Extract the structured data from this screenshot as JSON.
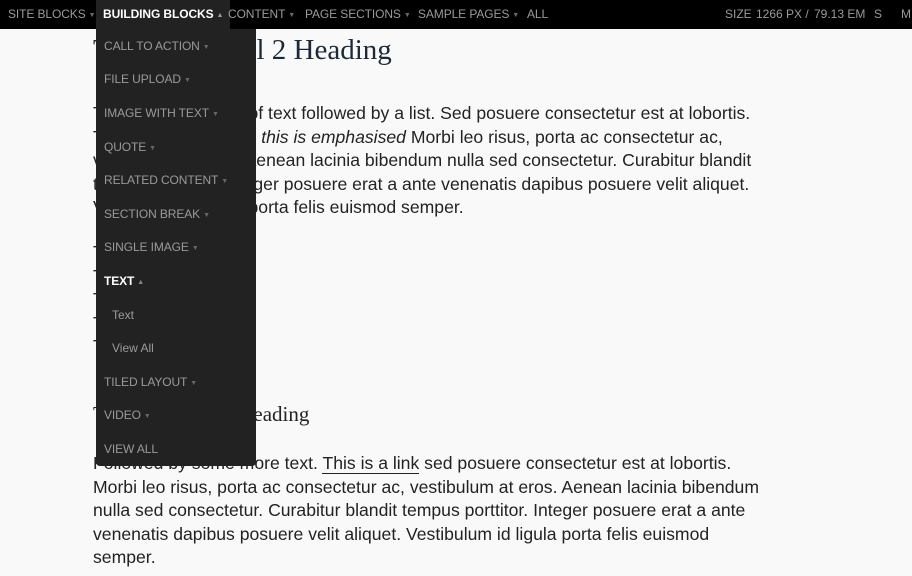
{
  "topbar": {
    "nav": [
      {
        "label": "SITE BLOCKS",
        "caret": "▼",
        "active": false
      },
      {
        "label": "BUILDING BLOCKS",
        "caret": "▲",
        "active": true
      },
      {
        "label": "CONTENT",
        "caret": "▼",
        "active": false
      },
      {
        "label": "PAGE SECTIONS",
        "caret": "▼",
        "active": false
      },
      {
        "label": "SAMPLE PAGES",
        "caret": "▼",
        "active": false
      },
      {
        "label": "ALL",
        "caret": "",
        "active": false
      }
    ],
    "size_label": "SIZE",
    "size_px": "1266 PX /",
    "size_em": "79.13 EM",
    "breakpoints": [
      "S",
      "M"
    ]
  },
  "dropdown": {
    "items": [
      {
        "label": "CALL TO ACTION",
        "caret": "▼"
      },
      {
        "label": "FILE UPLOAD",
        "caret": "▼"
      },
      {
        "label": "IMAGE WITH TEXT",
        "caret": "▼"
      },
      {
        "label": "QUOTE",
        "caret": "▼"
      },
      {
        "label": "RELATED CONTENT",
        "caret": "▼"
      },
      {
        "label": "SECTION BREAK",
        "caret": "▼"
      },
      {
        "label": "SINGLE IMAGE",
        "caret": "▼"
      },
      {
        "label": "TEXT",
        "caret": "▲",
        "open": true,
        "children": [
          "Text",
          "View All"
        ]
      },
      {
        "label": "TILED LAYOUT",
        "caret": "▼"
      },
      {
        "label": "VIDEO",
        "caret": "▼"
      },
      {
        "label": "VIEW ALL",
        "caret": ""
      }
    ]
  },
  "content": {
    "heading2": "This is a Level 2 Heading",
    "para1": {
      "line1": "This is a paragraph of text followed by a list. Sed posuere consectetur est at lobortis.",
      "line2_pre": "This is bold and here ",
      "line2_em": "this is emphasised",
      "line2_post": " Morbi leo risus, porta ac consectetur ac,",
      "line3": "vestibulum at eros. Aenean lacinia bibendum nulla sed consectetur. Curabitur blandit",
      "line4": "tempus porttitor. Integer posuere erat a ante venenatis dapibus posuere velit aliquet.",
      "line5": "Vestibulum id ligula porta felis euismod semper."
    },
    "list": [
      "This is a list",
      "This is an item",
      "This is an item",
      "This is a sub-item",
      "This is a list"
    ],
    "heading3": "This is a Level 3 Heading",
    "para2": {
      "line1_pre": "Followed by some more text. ",
      "link": "This is a link",
      "line1_post": " sed posuere consectetur est at lobortis.",
      "line2": "Morbi leo risus, porta ac consectetur ac, vestibulum at eros. Aenean lacinia bibendum",
      "line3": "nulla sed consectetur. Curabitur blandit tempus porttitor. Integer posuere erat a ante",
      "line4": "venenatis dapibus posuere velit aliquet. Vestibulum id ligula porta felis euismod",
      "line5": "semper."
    }
  }
}
